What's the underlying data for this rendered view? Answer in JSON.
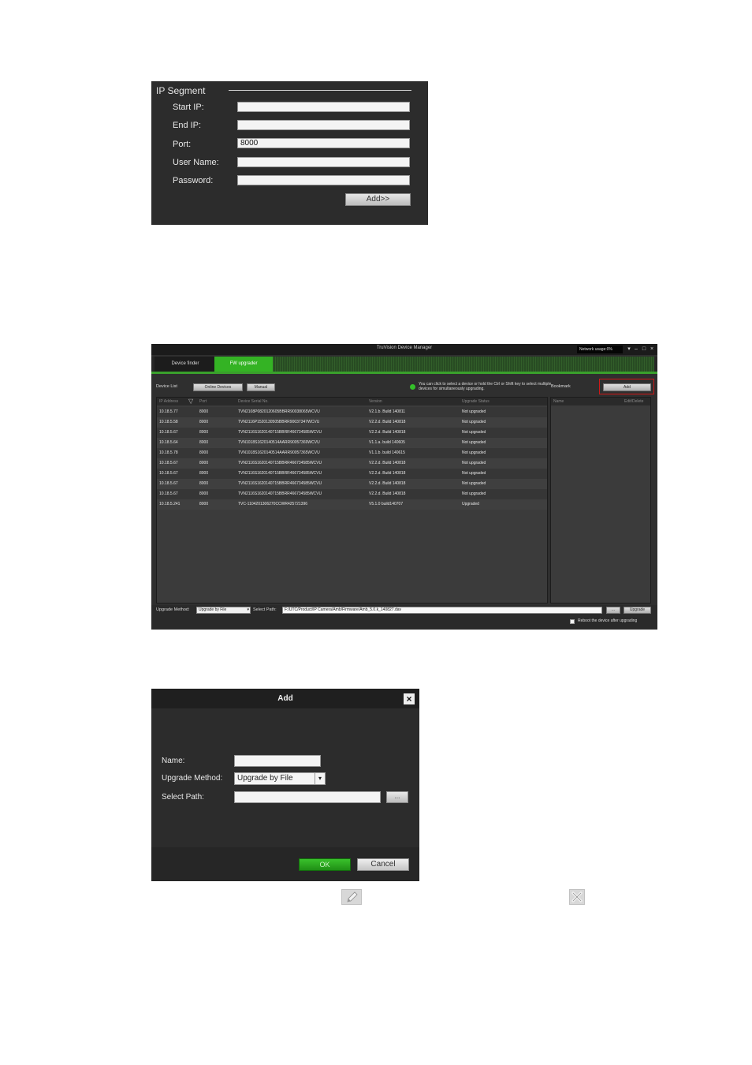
{
  "ip_segment": {
    "title": "IP Segment",
    "fields": [
      {
        "label": "Start IP:",
        "value": ""
      },
      {
        "label": "End IP:",
        "value": ""
      },
      {
        "label": "Port:",
        "value": "8000"
      },
      {
        "label": "User Name:",
        "value": ""
      },
      {
        "label": "Password:",
        "value": ""
      }
    ],
    "add_button": "Add>>"
  },
  "app": {
    "title": "TruVision Device Manager",
    "network_usage": "Network usage:0%",
    "window_controls": [
      "▾",
      "–",
      "□",
      "×"
    ],
    "tabs": [
      {
        "label": "Device finder",
        "active": false
      },
      {
        "label": "FW upgrader",
        "active": true
      }
    ],
    "toolbar": {
      "device_list_label": "Device List",
      "online_devices_button": "Online Devices",
      "manual_button": "Manual",
      "info_text": "You can click to select a device or hold the Ctrl or Shift key to select multiple devices for simultaneously upgrading.",
      "bookmark_label": "Bookmark",
      "add_button": "Add"
    },
    "columns": [
      "IP Address",
      "Port",
      "Device Serial No.",
      "Version",
      "Upgrade Status"
    ],
    "rows": [
      {
        "ip": "10.18.5.77",
        "port": "8000",
        "serial": "TVN2108P0820120605BBRR90038065WCVU",
        "version": "V2.1.b. Build 140811",
        "status": "Not upgraded"
      },
      {
        "ip": "10.18.5.58",
        "port": "8000",
        "serial": "TVN2116P1520130505BBRR90037347WCVU",
        "version": "V2.2.d. Build 140818",
        "status": "Not upgraded"
      },
      {
        "ip": "10.18.5.67",
        "port": "8000",
        "serial": "TVN2116S1620140715BBRR466734585WCVU",
        "version": "V2.2.d. Build 140818",
        "status": "Not upgraded"
      },
      {
        "ip": "10.18.5.64",
        "port": "8000",
        "serial": "TVN1018S1620140514AARR90057369WCVU",
        "version": "V1.1.a. build 140605",
        "status": "Not upgraded"
      },
      {
        "ip": "10.18.5.78",
        "port": "8000",
        "serial": "TVN1018S1620140514AARR90057365WCVU",
        "version": "V1.1.b. build 140615",
        "status": "Not upgraded"
      },
      {
        "ip": "10.18.5.67",
        "port": "8000",
        "serial": "TVN2116S1620140715BBRR466734585WCVU",
        "version": "V2.2.d. Build 140818",
        "status": "Not upgraded"
      },
      {
        "ip": "10.18.5.67",
        "port": "8000",
        "serial": "TVN2116S1620140715BBRR466734585WCVU",
        "version": "V2.2.d. Build 140818",
        "status": "Not upgraded"
      },
      {
        "ip": "10.18.5.67",
        "port": "8000",
        "serial": "TVN2116S1620140715BBRR466734585WCVU",
        "version": "V2.2.d. Build 140818",
        "status": "Not upgraded"
      },
      {
        "ip": "10.18.5.67",
        "port": "8000",
        "serial": "TVN2116S1620140715BBRR466734585WCVU",
        "version": "V2.2.d. Build 140818",
        "status": "Not upgraded"
      },
      {
        "ip": "10.18.5.241",
        "port": "8000",
        "serial": "TVC-1104201306270CCWR425721396",
        "version": "V5.1.0 build140707",
        "status": "Upgraded"
      }
    ],
    "bookmark_columns": [
      "Name",
      "Edit/Delete"
    ],
    "bottom": {
      "upgrade_method_label": "Upgrade Method:",
      "upgrade_method_value": "Upgrade by File",
      "select_path_label": "Select Path:",
      "select_path_value": "F:/UTC/Product/IP Camera/Amb/Firmware/Amb_5.0.k_140827.dav",
      "browse_button": "...",
      "upgrade_button": "Upgrade",
      "reboot_label": "Reboot the device after upgrading"
    }
  },
  "add_dialog": {
    "title": "Add",
    "close": "×",
    "name_label": "Name:",
    "name_value": "",
    "upgrade_method_label": "Upgrade Method:",
    "upgrade_method_value": "Upgrade by File",
    "select_path_label": "Select Path:",
    "select_path_value": "",
    "browse_button": "...",
    "ok_button": "OK",
    "cancel_button": "Cancel"
  },
  "colors": {
    "panel_bg": "#2c2c2c",
    "accent_green": "#34b324",
    "highlight_red": "#d01818"
  },
  "icons": {
    "edit": "pencil-icon",
    "delete": "delete-x-icon"
  }
}
